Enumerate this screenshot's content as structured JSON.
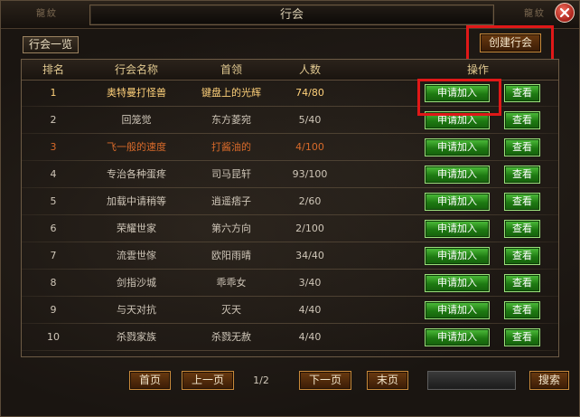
{
  "window": {
    "title": "行会",
    "dragon_left": "龍紋",
    "dragon_right": "龍紋"
  },
  "tabs": {
    "list_label": "行会一览"
  },
  "create_button_label": "创建行会",
  "table": {
    "headers": [
      "排名",
      "行会名称",
      "首领",
      "人数",
      "操作"
    ],
    "rows": [
      {
        "rank": "1",
        "name": "奥特曼打怪兽",
        "leader": "键盘上的光辉",
        "members": "74/80",
        "join": "申请加入",
        "view": "查看",
        "highlight": "gold"
      },
      {
        "rank": "2",
        "name": "回笼觉",
        "leader": "东方菱宛",
        "members": "5/40",
        "join": "申请加入",
        "view": "查看",
        "highlight": "none"
      },
      {
        "rank": "3",
        "name": "飞一般的速度",
        "leader": "打酱油的",
        "members": "4/100",
        "join": "申请加入",
        "view": "查看",
        "highlight": "orange"
      },
      {
        "rank": "4",
        "name": "专治各种蛋疼",
        "leader": "司马昆轩",
        "members": "93/100",
        "join": "申请加入",
        "view": "查看",
        "highlight": "none"
      },
      {
        "rank": "5",
        "name": "加载中请稍等",
        "leader": "逍遥痞子",
        "members": "2/60",
        "join": "申请加入",
        "view": "查看",
        "highlight": "none"
      },
      {
        "rank": "6",
        "name": "荣耀世家",
        "leader": "第六方向",
        "members": "2/100",
        "join": "申请加入",
        "view": "查看",
        "highlight": "none"
      },
      {
        "rank": "7",
        "name": "流雲世傢",
        "leader": "欧阳雨晴",
        "members": "34/40",
        "join": "申请加入",
        "view": "查看",
        "highlight": "none"
      },
      {
        "rank": "8",
        "name": "剑指沙城",
        "leader": "乖乖女",
        "members": "3/40",
        "join": "申请加入",
        "view": "查看",
        "highlight": "none"
      },
      {
        "rank": "9",
        "name": "与天对抗",
        "leader": "灭天",
        "members": "4/40",
        "join": "申请加入",
        "view": "查看",
        "highlight": "none"
      },
      {
        "rank": "10",
        "name": "杀戮家族",
        "leader": "杀戮无赦",
        "members": "4/40",
        "join": "申请加入",
        "view": "查看",
        "highlight": "none"
      }
    ]
  },
  "pagination": {
    "first": "首页",
    "prev": "上一页",
    "page_info": "1/2",
    "next": "下一页",
    "last": "末页",
    "search_value": "",
    "search_button": "搜索"
  },
  "colors": {
    "gold_text": "#ffd17a",
    "orange_text": "#d86a2a",
    "normal_text": "#cfc6b8",
    "header_text": "#e0c890",
    "annotation_red": "#e01818"
  },
  "icons": {
    "close": "close-icon"
  }
}
